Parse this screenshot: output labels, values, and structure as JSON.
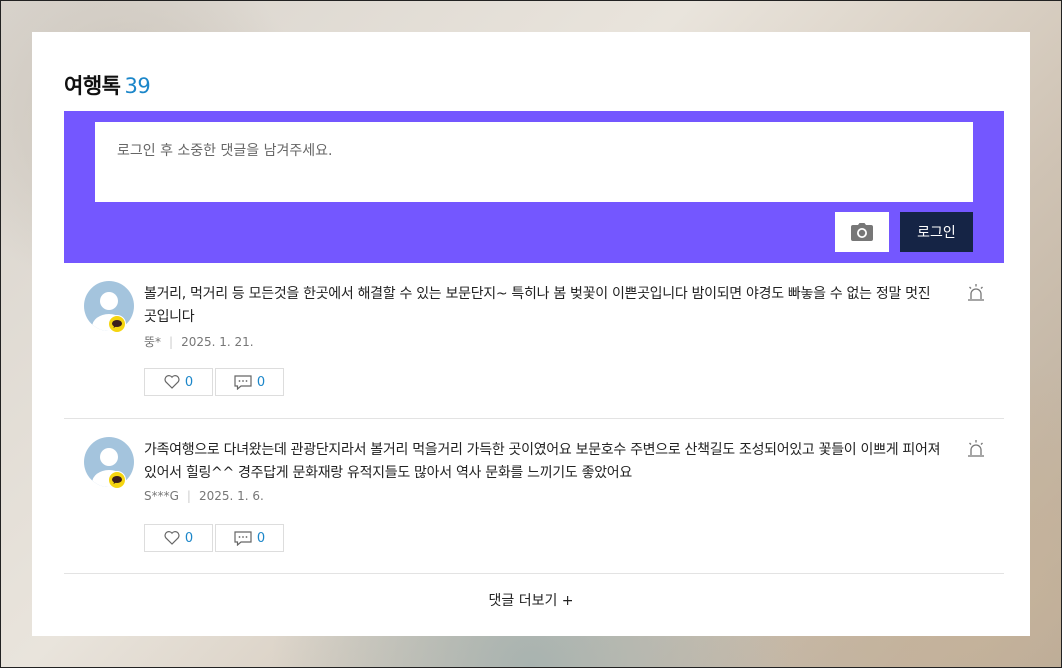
{
  "section": {
    "title": "여행톡",
    "count": "39"
  },
  "comment_form": {
    "placeholder": "로그인 후 소중한 댓글을 남겨주세요.",
    "camera_icon": "camera-icon",
    "login_label": "로그인"
  },
  "comments": [
    {
      "text": "볼거리, 먹거리 등 모든것을 한곳에서 해결할 수 있는 보문단지~ 특히나 봄 벚꽃이 이쁜곳입니다 밤이되면 야경도 빠놓을 수 없는 정말 멋진 곳입니다",
      "author": "뚱*",
      "date": "2025. 1. 21.",
      "likes": "0",
      "replies": "0"
    },
    {
      "text": "가족여행으로 다녀왔는데 관광단지라서 볼거리 먹을거리 가득한 곳이였어요 보문호수 주변으로 산책길도 조성되어있고 꽃들이 이쁘게 피어져 있어서 힐링^^ 경주답게 문화재랑 유적지들도 많아서 역사 문화를 느끼기도 좋았어요",
      "author": "S***G",
      "date": "2025. 1. 6.",
      "likes": "0",
      "replies": "0"
    }
  ],
  "more_label": "댓글 더보기 +",
  "colors": {
    "accent": "#7457ff",
    "login": "#152445",
    "count": "#1b86c9",
    "kakao": "#f5d510"
  }
}
